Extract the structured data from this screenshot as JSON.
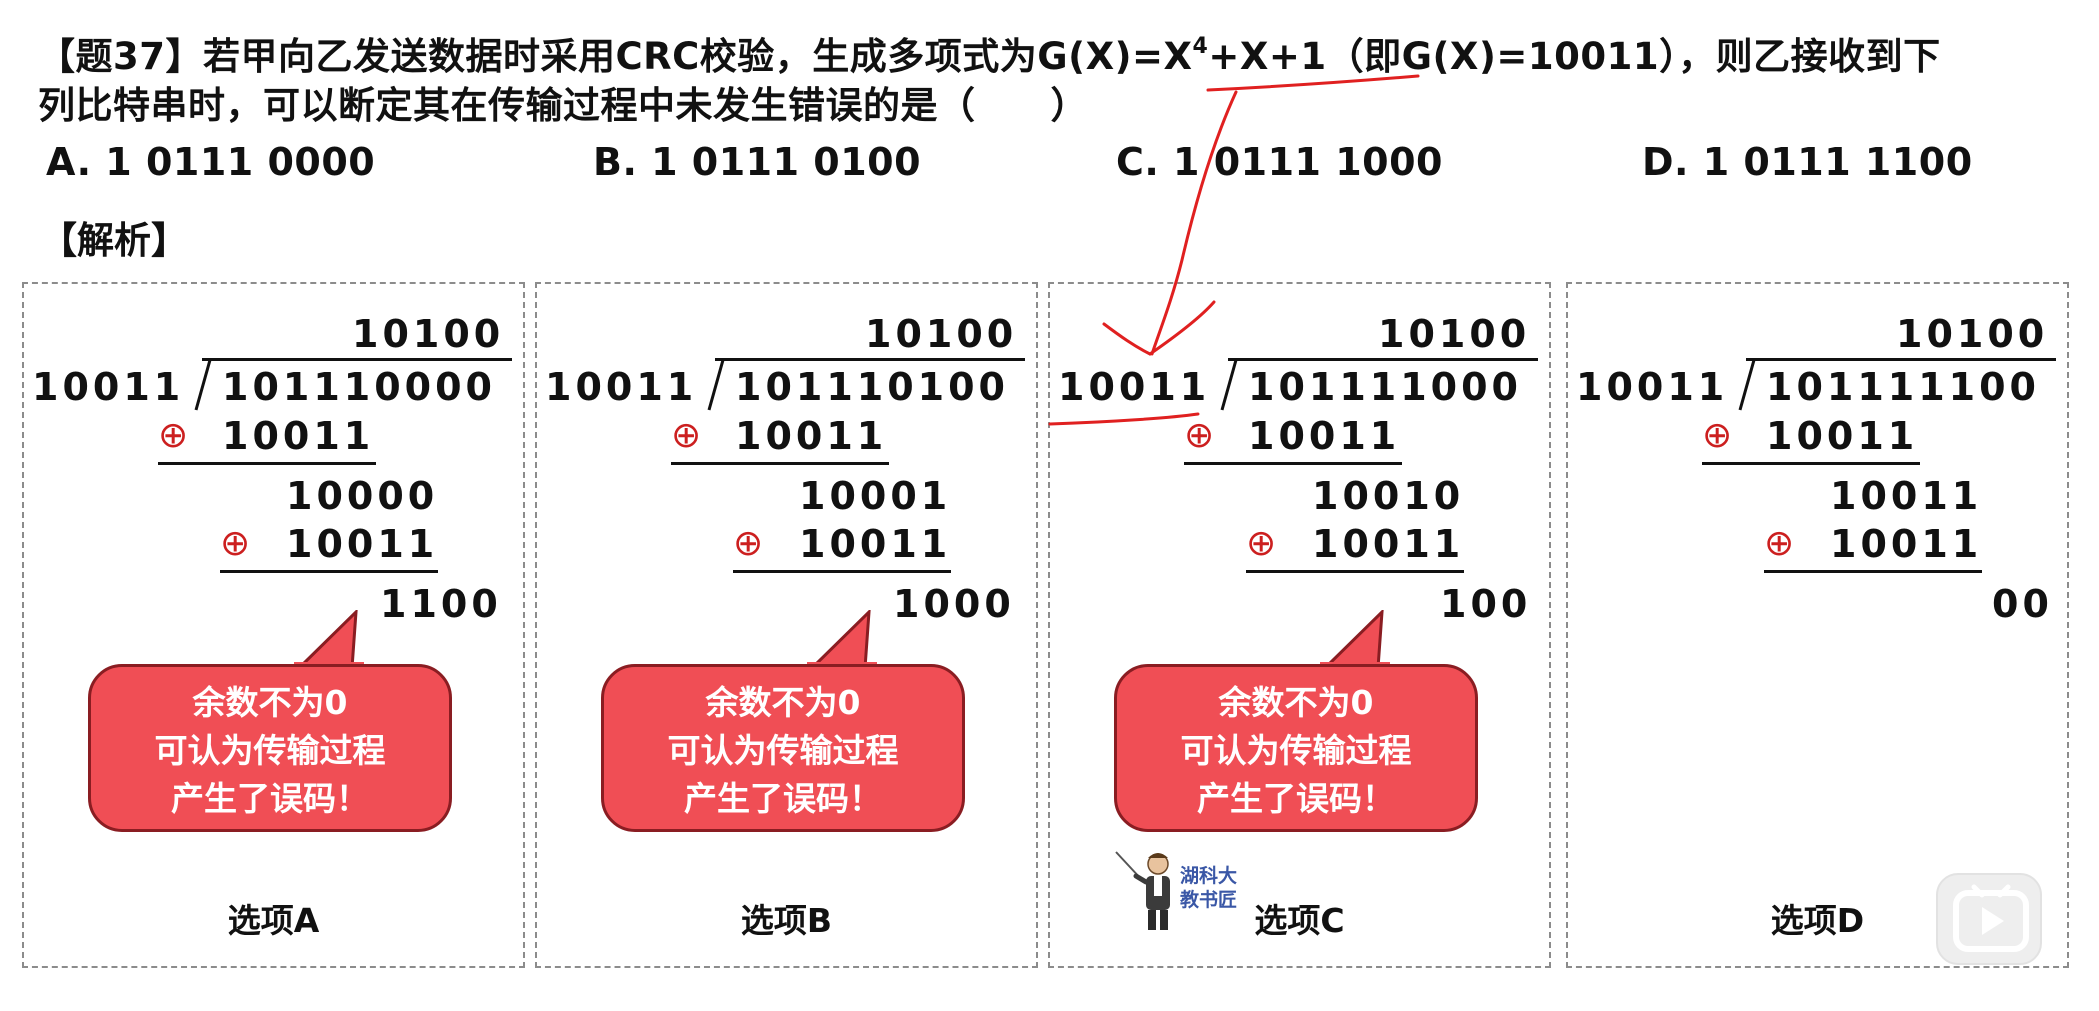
{
  "question": {
    "line1_before_sup": "【题37】若甲向乙发送数据时采用CRC校验，生成多项式为G(X)=X",
    "sup": "4",
    "line1_after_sup": "+X+1（即G(X)=10011），则乙接收到下",
    "line2": "列比特串时，可以断定其在传输过程中未发生错误的是（　　）"
  },
  "options": [
    {
      "label": "A. 1 0111 0000"
    },
    {
      "label": "B. 1 0111 0100"
    },
    {
      "label": "C. 1 0111 1000"
    },
    {
      "label": "D. 1 0111 1100"
    }
  ],
  "analysis_label": "【解析】",
  "xor_symbol": "⊕",
  "panels": [
    {
      "quotient": "10100",
      "divisor": "10011",
      "dividend": "101110000",
      "sub1": "10011",
      "mid": "10000",
      "sub2": "10011",
      "remainder": "1100",
      "callout": [
        "余数不为0",
        "可认为传输过程",
        "产生了误码！"
      ],
      "caption": "选项A"
    },
    {
      "quotient": "10100",
      "divisor": "10011",
      "dividend": "101110100",
      "sub1": "10011",
      "mid": "10001",
      "sub2": "10011",
      "remainder": "1000",
      "callout": [
        "余数不为0",
        "可认为传输过程",
        "产生了误码！"
      ],
      "caption": "选项B"
    },
    {
      "quotient": "10100",
      "divisor": "10011",
      "dividend": "101111000",
      "sub1": "10011",
      "mid": "10010",
      "sub2": "10011",
      "remainder": "100",
      "callout": [
        "余数不为0",
        "可认为传输过程",
        "产生了误码！"
      ],
      "caption": "选项C"
    },
    {
      "quotient": "10100",
      "divisor": "10011",
      "dividend": "101111100",
      "sub1": "10011",
      "mid": "10011",
      "sub2": "10011",
      "remainder": "00",
      "callout": [],
      "caption": "选项D"
    }
  ],
  "watermark": {
    "line1": "湖科大",
    "line2": "教书匠"
  },
  "colors": {
    "callout_fill": "#f04e55",
    "callout_border": "#8a1d22",
    "annotation_red": "#e02020",
    "xor_red": "#cc1f1f",
    "panel_border": "#8c8c8c"
  },
  "icons": [
    "play-button-icon",
    "teacher-avatar-icon"
  ]
}
